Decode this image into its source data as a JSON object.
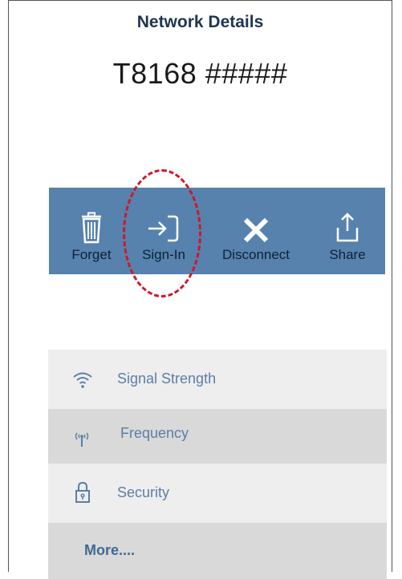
{
  "header": {
    "title": "Network Details"
  },
  "network": {
    "name": "T8168 #####"
  },
  "actions": [
    {
      "label": "Forget",
      "icon": "trash-icon"
    },
    {
      "label": "Sign-In",
      "icon": "sign-in-icon"
    },
    {
      "label": "Disconnect",
      "icon": "close-x-icon"
    },
    {
      "label": "Share",
      "icon": "share-icon"
    }
  ],
  "details": [
    {
      "label": "Signal Strength",
      "icon": "wifi-icon"
    },
    {
      "label": "Frequency",
      "icon": "antenna-icon"
    },
    {
      "label": "Security",
      "icon": "lock-icon"
    }
  ],
  "more": {
    "label": "More...."
  },
  "colors": {
    "action_bar": "#5682ad",
    "action_label": "#0d2238",
    "list_text": "#5b7ea6",
    "highlight": "#d0162a"
  }
}
